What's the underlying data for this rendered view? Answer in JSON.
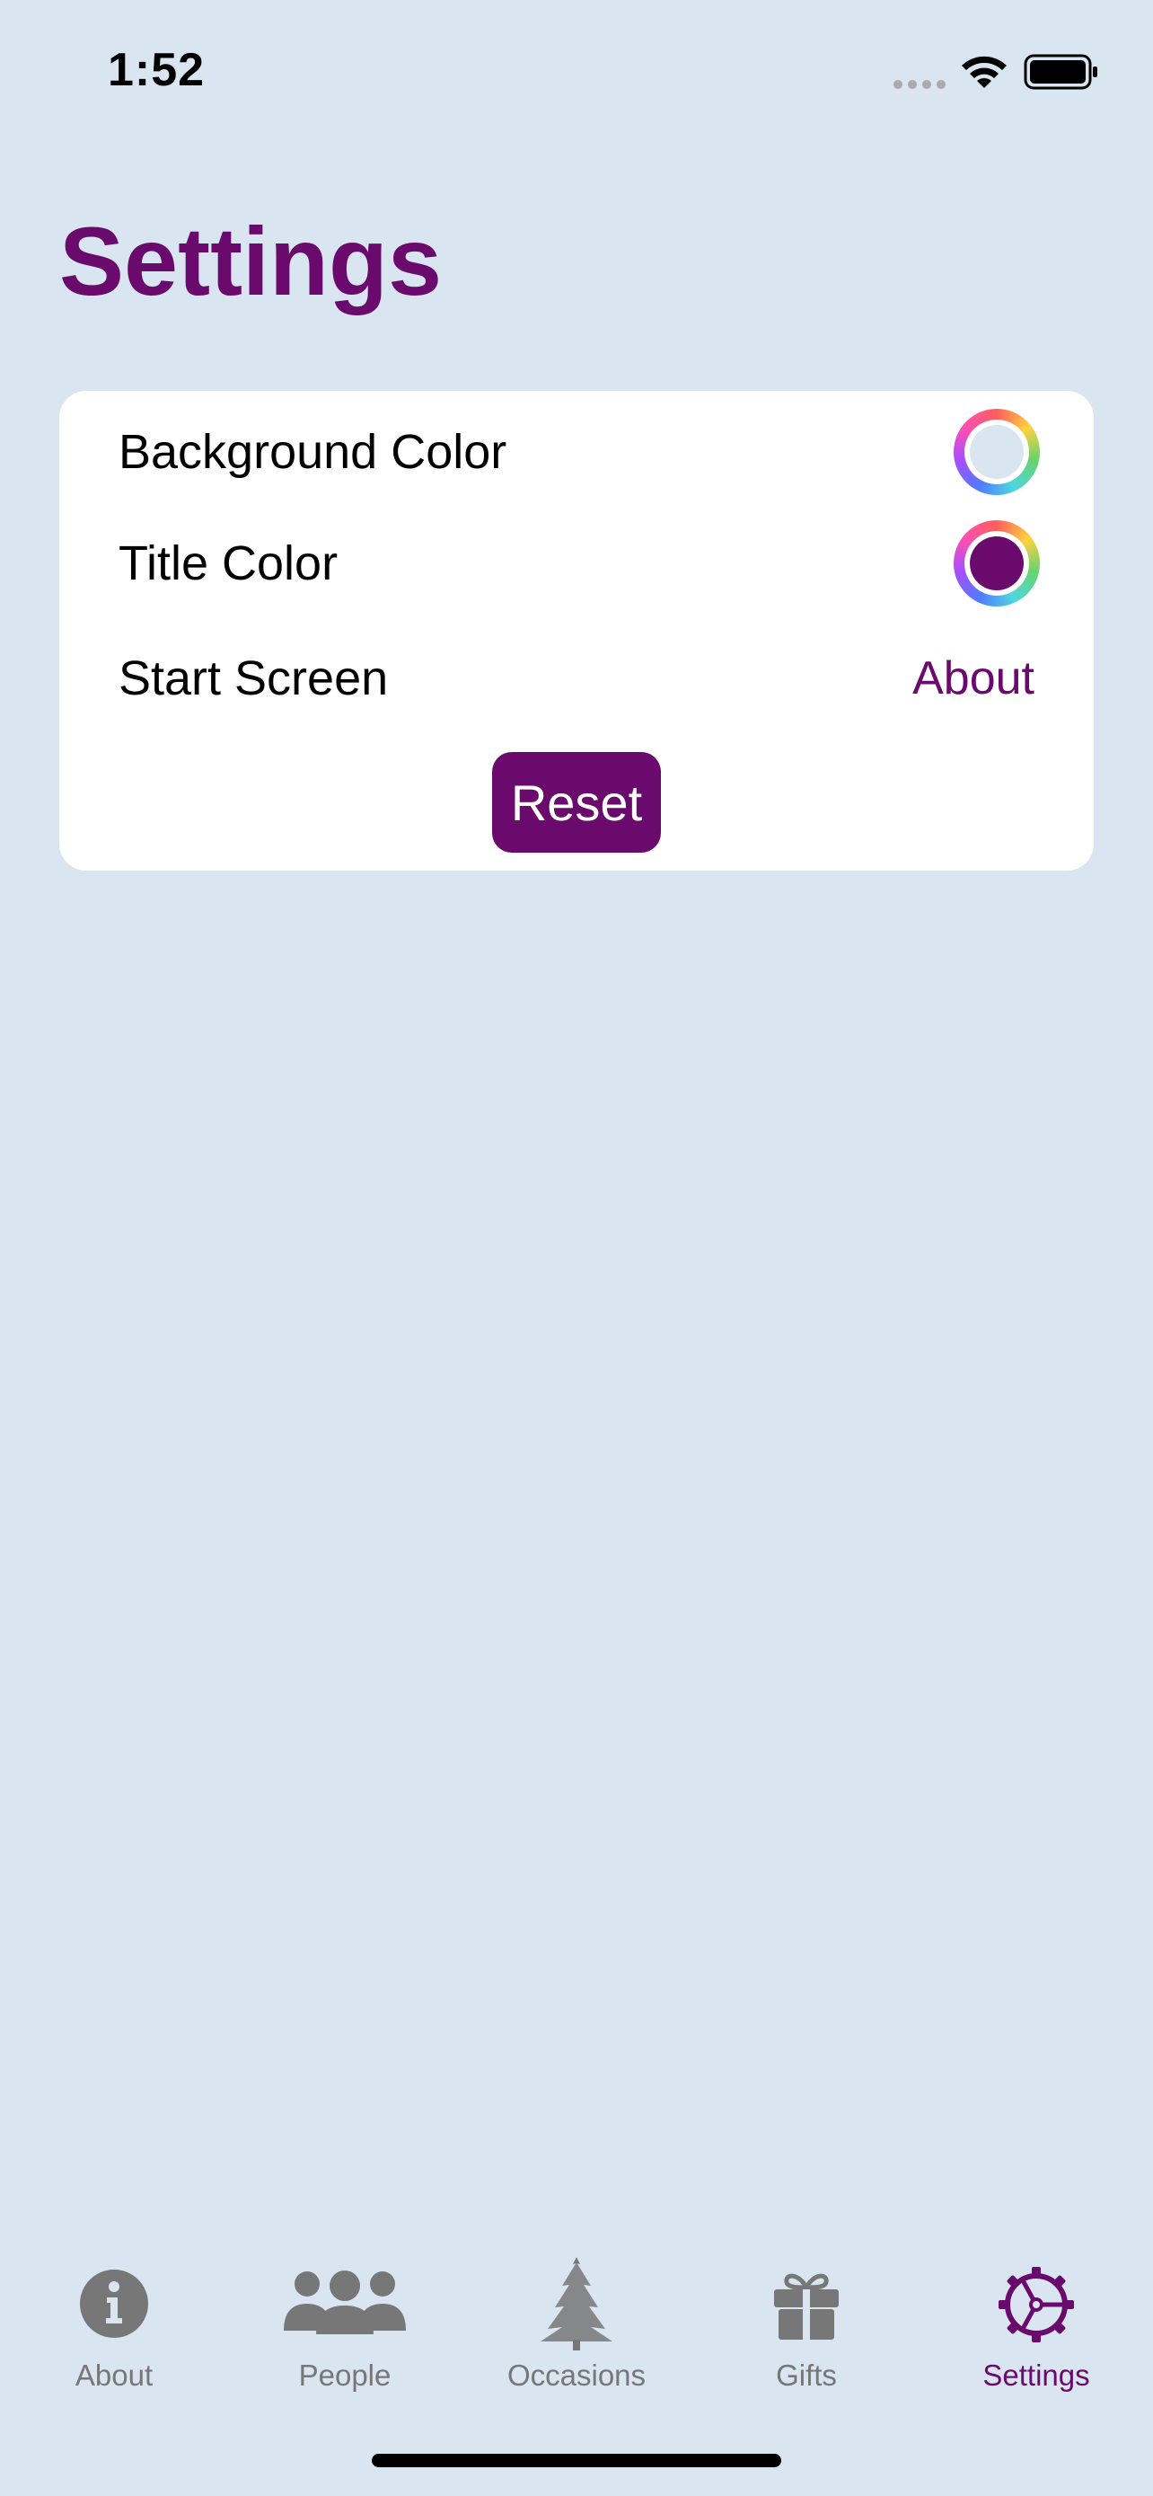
{
  "status_bar": {
    "time": "1:52"
  },
  "colors": {
    "background": "#dae5f2",
    "title": "#6b0a6d",
    "tab_inactive": "#777777",
    "tab_active": "#6b0a6d",
    "card": "#ffffff"
  },
  "header": {
    "title": "Settings"
  },
  "settings": {
    "background_color_label": "Background Color",
    "background_color_value": "#dae5f2",
    "title_color_label": "Title Color",
    "title_color_value": "#6b0a6d",
    "start_screen_label": "Start Screen",
    "start_screen_value": "About",
    "reset_label": "Reset"
  },
  "tab_bar": {
    "items": [
      {
        "label": "About",
        "icon": "info-circle-icon",
        "active": false
      },
      {
        "label": "People",
        "icon": "people-group-icon",
        "active": false
      },
      {
        "label": "Occasions",
        "icon": "tree-icon",
        "active": false
      },
      {
        "label": "Gifts",
        "icon": "gift-icon",
        "active": false
      },
      {
        "label": "Settings",
        "icon": "gear-icon",
        "active": true
      }
    ]
  }
}
